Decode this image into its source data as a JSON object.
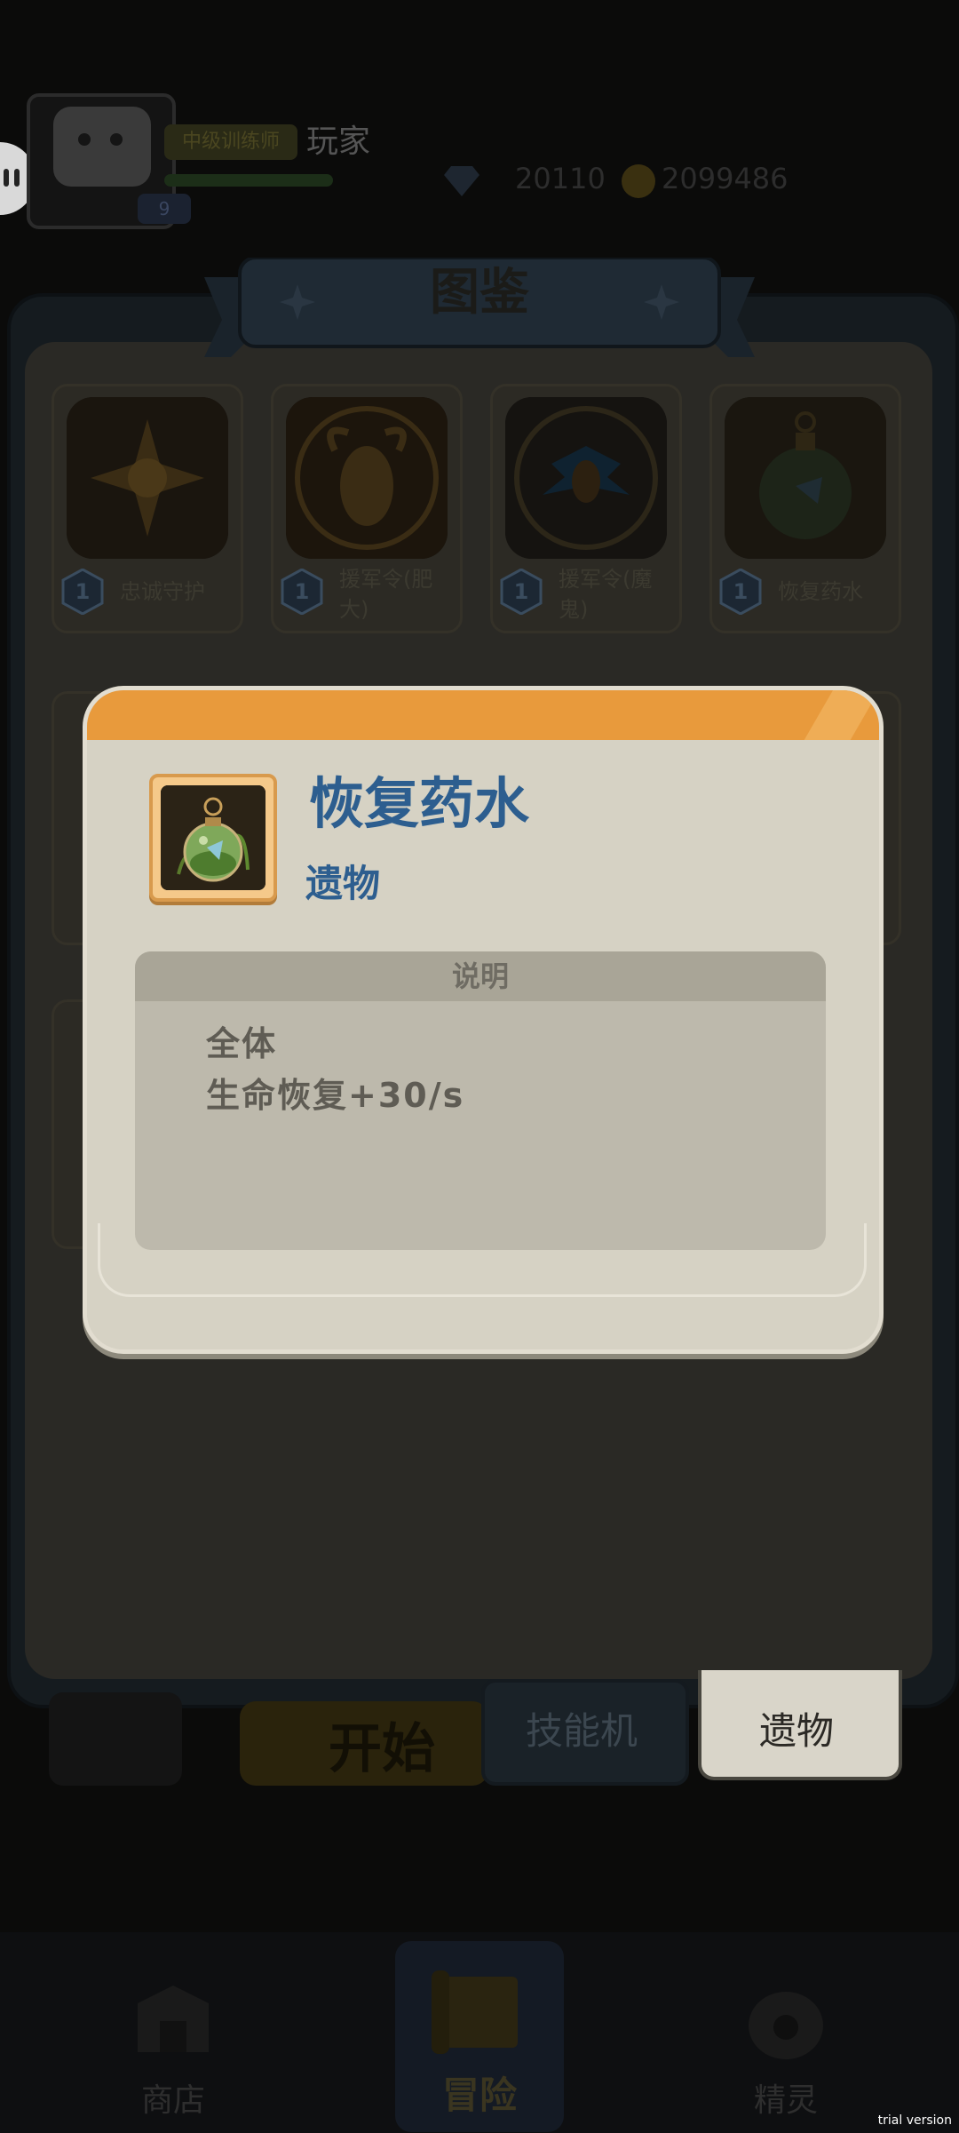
{
  "player": {
    "rank_badge": "中级训练师",
    "name": "玩家",
    "level": "9",
    "gems": "20110",
    "coins": "2099486"
  },
  "album": {
    "title": "图鉴",
    "cards": [
      {
        "level": "1",
        "label": "忠诚守护"
      },
      {
        "level": "1",
        "label": "援军令(肥大)"
      },
      {
        "level": "1",
        "label": "援军令(魔鬼)"
      },
      {
        "level": "1",
        "label": "恢复药水"
      }
    ],
    "tabs": {
      "skill": "技能机",
      "relic": "遗物"
    },
    "start_button": "开始"
  },
  "bottom_nav": {
    "shop": "商店",
    "adventure": "冒险",
    "pet": "精灵"
  },
  "modal": {
    "item_name": "恢复药水",
    "item_type": "遗物",
    "desc_header": "说明",
    "desc_lines": [
      "全体",
      "生命恢复+30/s"
    ]
  },
  "watermark": "trial version",
  "colors": {
    "modal_header": "#e89a3c",
    "title_blue": "#2d5e8f",
    "modal_body": "#d6d2c4"
  }
}
